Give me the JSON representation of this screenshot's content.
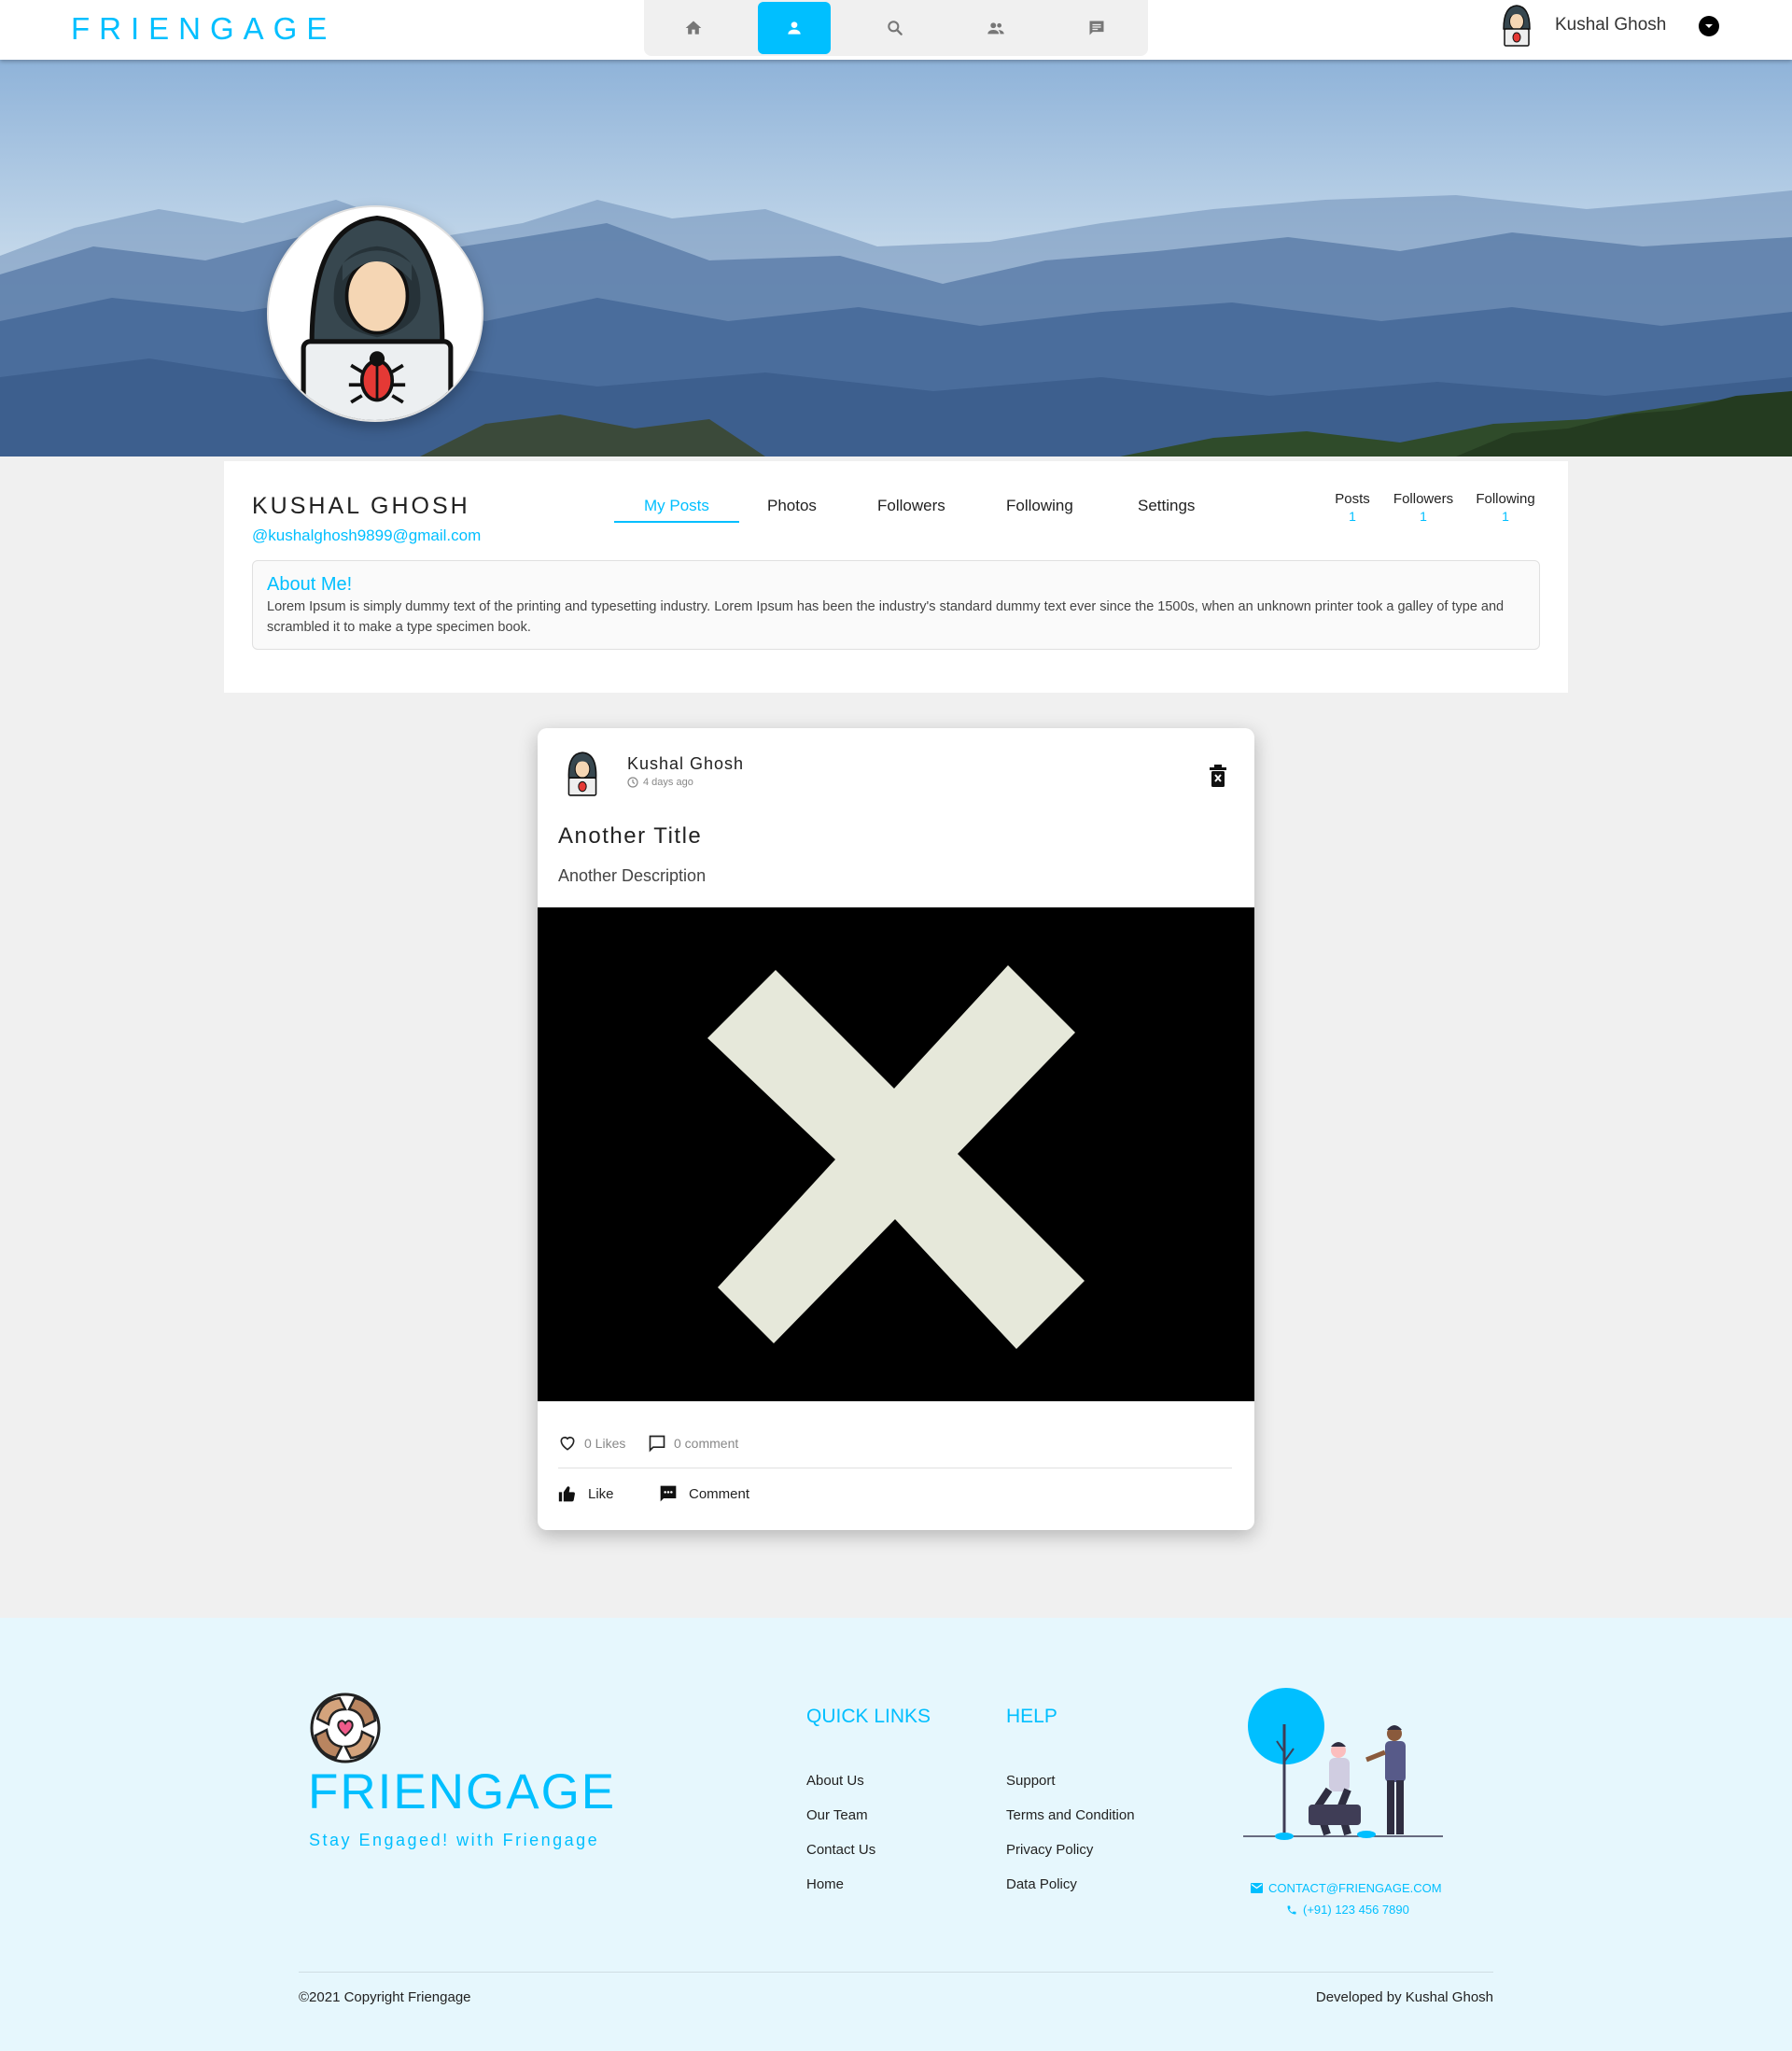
{
  "nav": {
    "brand": "FRIENGAGE",
    "icons": [
      "home-icon",
      "profile-icon",
      "search-icon",
      "friends-icon",
      "chat-icon"
    ],
    "active_index": 1,
    "username": "Kushal Ghosh"
  },
  "profile": {
    "name": "KUSHAL GHOSH",
    "email": "@kushalghosh9899@gmail.com",
    "tabs": [
      "My Posts",
      "Photos",
      "Followers",
      "Following",
      "Settings"
    ],
    "active_tab": "My Posts",
    "stats": [
      {
        "label": "Posts",
        "value": "1"
      },
      {
        "label": "Followers",
        "value": "1"
      },
      {
        "label": "Following",
        "value": "1"
      }
    ],
    "about_title": "About Me!",
    "about_text": "Lorem Ipsum is simply dummy text of the printing and typesetting industry. Lorem Ipsum has been the industry's standard dummy text ever since the 1500s, when an unknown printer took a galley of type and scrambled it to make a type specimen book."
  },
  "post": {
    "author": "Kushal Ghosh",
    "time": "4 days ago",
    "title": "Another Title",
    "description": "Another Description",
    "likes": "0 Likes",
    "comments": "0 comment",
    "like_label": "Like",
    "comment_label": "Comment"
  },
  "footer": {
    "brand": "FRIENGAGE",
    "tagline": "Stay Engaged! with Friengage",
    "quick_links_title": "QUICK LINKS",
    "quick_links": [
      "About Us",
      "Our Team",
      "Contact Us",
      "Home"
    ],
    "help_title": "HELP",
    "help_links": [
      "Support",
      "Terms and Condition",
      "Privacy Policy",
      "Data Policy"
    ],
    "email": "CONTACT@FRIENGAGE.COM",
    "phone": "(+91) 123 456 7890",
    "copyright": "©2021 Copyright Friengage",
    "developer": "Developed by Kushal Ghosh"
  },
  "colors": {
    "accent": "#00bfff",
    "footer_bg": "#e6f7fd",
    "page_bg": "#f0f0f0"
  }
}
